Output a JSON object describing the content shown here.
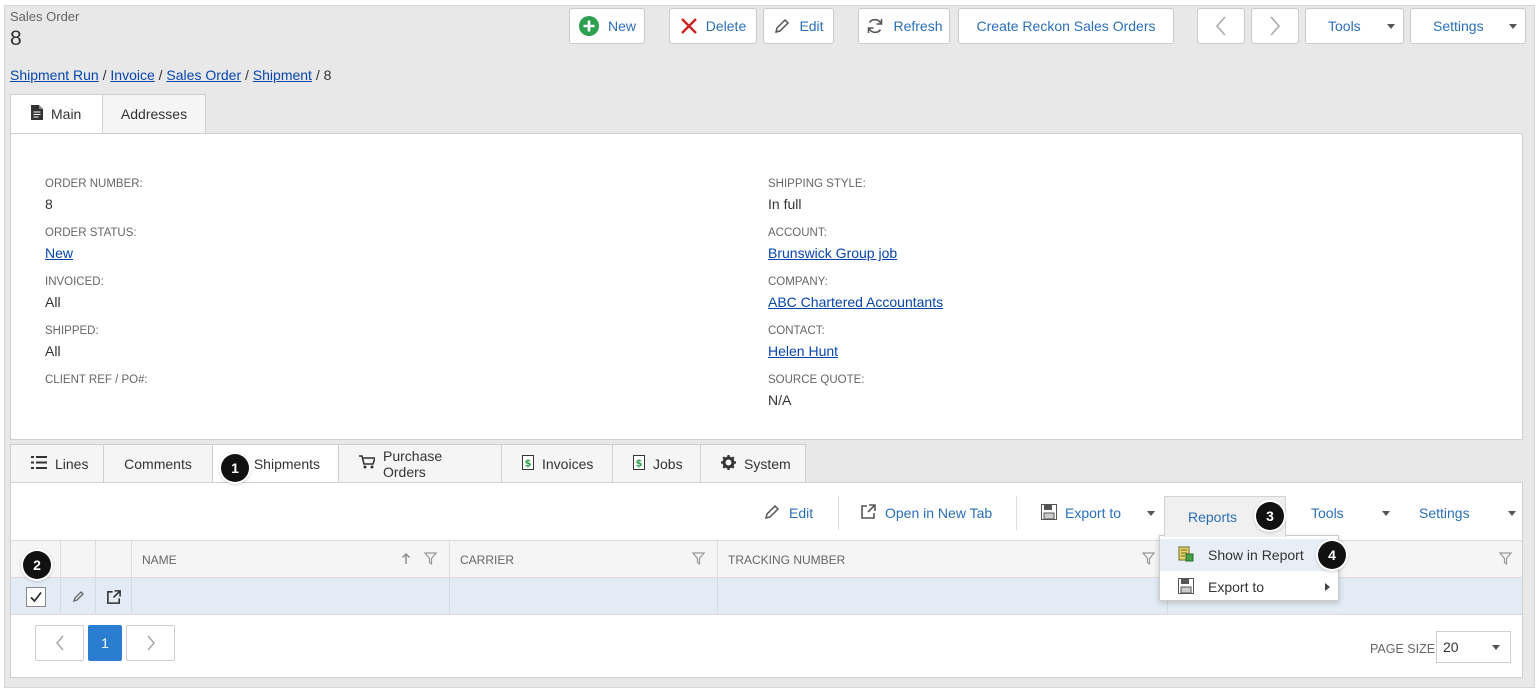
{
  "header": {
    "entity_label": "Sales Order",
    "entity_id": "8"
  },
  "toolbar": {
    "new_label": "New",
    "delete_label": "Delete",
    "edit_label": "Edit",
    "refresh_label": "Refresh",
    "create_reckon_label": "Create Reckon Sales Orders",
    "tools_label": "Tools",
    "settings_label": "Settings"
  },
  "breadcrumb": {
    "items": [
      "Shipment Run",
      "Invoice",
      "Sales Order",
      "Shipment"
    ],
    "separator": "/",
    "current": "8"
  },
  "top_tabs": [
    {
      "label": "Main"
    },
    {
      "label": "Addresses"
    }
  ],
  "fields_left": [
    {
      "label": "ORDER NUMBER:",
      "value": "8"
    },
    {
      "label": "ORDER STATUS:",
      "value": "New"
    },
    {
      "label": "INVOICED:",
      "value": "All"
    },
    {
      "label": "SHIPPED:",
      "value": "All"
    },
    {
      "label": "CLIENT REF / PO#:",
      "value": ""
    }
  ],
  "fields_right": [
    {
      "label": "SHIPPING STYLE:",
      "value": "In full"
    },
    {
      "label": "ACCOUNT:",
      "value": "Brunswick Group job"
    },
    {
      "label": "COMPANY:",
      "value": "ABC Chartered Accountants"
    },
    {
      "label": "CONTACT:",
      "value": "Helen Hunt"
    },
    {
      "label": "SOURCE QUOTE:",
      "value": "N/A"
    }
  ],
  "bottom_tabs": [
    {
      "label": "Lines"
    },
    {
      "label": "Comments"
    },
    {
      "label": "Shipments"
    },
    {
      "label": "Purchase Orders"
    },
    {
      "label": "Invoices"
    },
    {
      "label": "Jobs"
    },
    {
      "label": "System"
    }
  ],
  "grid_toolbar": {
    "edit_label": "Edit",
    "open_new_tab_label": "Open in New Tab",
    "export_label": "Export to",
    "reports_label": "Reports",
    "tools_label": "Tools",
    "settings_label": "Settings"
  },
  "grid": {
    "columns": [
      "NAME",
      "CARRIER",
      "TRACKING NUMBER"
    ],
    "row_checked": true
  },
  "reports_menu": {
    "items": [
      "Show in Report",
      "Export to"
    ]
  },
  "pager": {
    "current_page": "1",
    "page_size_label": "PAGE SIZE",
    "page_size": "20"
  },
  "annotations": [
    "1",
    "2",
    "3",
    "4"
  ],
  "colors": {
    "link": "#0645ad",
    "accent": "#2a6fb6",
    "page_active": "#2a7dd1",
    "new_icon": "#2e9e4f",
    "delete_icon": "#cc2222"
  }
}
